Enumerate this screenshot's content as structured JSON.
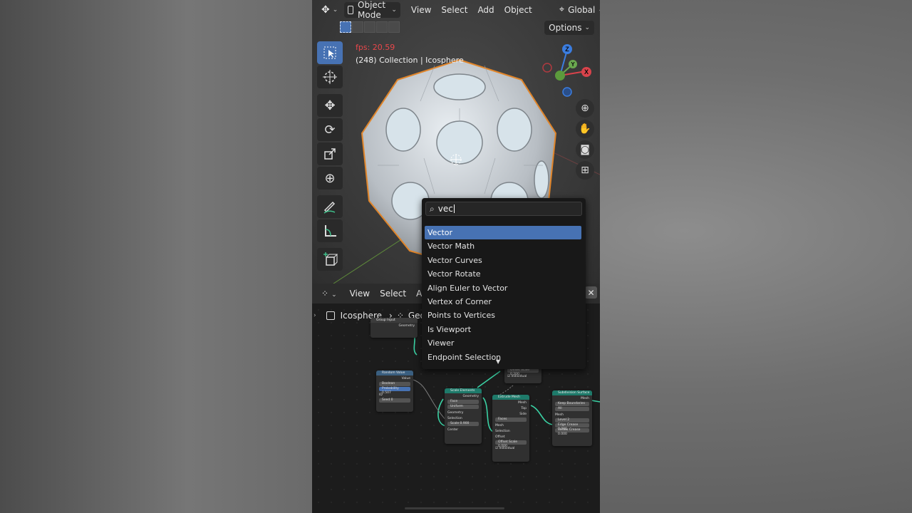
{
  "header": {
    "mode": "Object Mode",
    "menus": [
      "View",
      "Select",
      "Add",
      "Object"
    ],
    "orientation": "Global",
    "options": "Options"
  },
  "overlay": {
    "fps": "fps: 20.59",
    "collection": "(248) Collection | Icosphere"
  },
  "gizmo": {
    "z": "Z",
    "y": "Y",
    "x": "X"
  },
  "node_editor": {
    "menus": [
      "View",
      "Select",
      "Add"
    ],
    "object": "Icosphere",
    "modifier": "Geo"
  },
  "search": {
    "query": "vec",
    "results": [
      "Vector",
      "Vector Math",
      "Vector Curves",
      "Vector Rotate",
      "Align Euler to Vector",
      "Vertex of Corner",
      "Points to Vertices",
      "Is Viewport",
      "Viewer",
      "Endpoint Selection"
    ],
    "selected_index": 0
  },
  "colors": {
    "accent": "#4772b3",
    "fps": "#e8474b",
    "node_geometry": "#1e7a6a"
  }
}
